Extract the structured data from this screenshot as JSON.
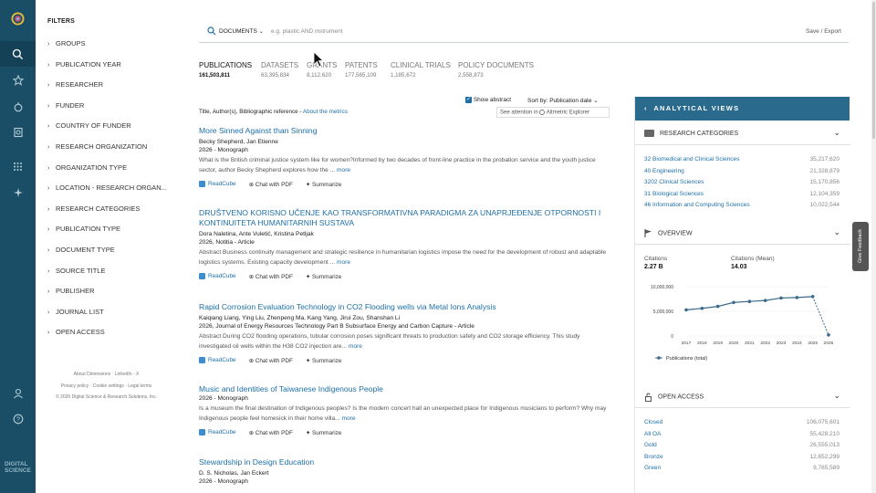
{
  "nav": {
    "icons": [
      "logo-icon",
      "search-icon",
      "star-icon",
      "saved-searches-icon",
      "history-icon",
      "apps-icon",
      "sparkle-icon",
      "user-icon",
      "help-icon"
    ],
    "brand": [
      "DIGITAL",
      "SCIENCE"
    ]
  },
  "filters": {
    "title": "FILTERS",
    "items": [
      "GROUPS",
      "PUBLICATION YEAR",
      "RESEARCHER",
      "FUNDER",
      "COUNTRY OF FUNDER",
      "RESEARCH ORGANIZATION",
      "ORGANIZATION TYPE",
      "LOCATION - RESEARCH ORGAN...",
      "RESEARCH CATEGORIES",
      "PUBLICATION TYPE",
      "DOCUMENT TYPE",
      "SOURCE TITLE",
      "PUBLISHER",
      "JOURNAL LIST",
      "OPEN ACCESS"
    ],
    "footer1": "About Dimensions · LinkedIn · X",
    "footer2": "Privacy policy · Cookie settings · Legal terms",
    "footer3": "© 2026 Digital Science & Research Solutions, Inc."
  },
  "search": {
    "scope": "DOCUMENTS",
    "placeholder": "e.g. plastic AND instrument",
    "save_export": "Save / Export"
  },
  "tabs": [
    {
      "label": "PUBLICATIONS",
      "count": "161,503,811"
    },
    {
      "label": "DATASETS",
      "count": "63,395,834"
    },
    {
      "label": "GRANTS",
      "count": "8,112,620"
    },
    {
      "label": "PATENTS",
      "count": "177,565,109"
    },
    {
      "label": "CLINICAL TRIALS",
      "count": "1,185,672"
    },
    {
      "label": "POLICY DOCUMENTS",
      "count": "2,558,873"
    }
  ],
  "options": {
    "show_abstract": "Show abstract",
    "sort_by": "Sort by:",
    "sort_value": "Publication date",
    "bib": "Title, Author(s), Bibliographic reference -",
    "metrics_link": "About the metrics",
    "altmetric": "See attention in",
    "altmetric_name": "Altmetric Explorer"
  },
  "actions": {
    "readcube": "ReadCube",
    "chat": "Chat with PDF",
    "summarize": "Summarize",
    "more": "more"
  },
  "publications": [
    {
      "title": "More Sinned Against than Sinning",
      "authors": "Becky Shepherd, Jan Etienne",
      "meta": "2026 - Monograph",
      "abstract": "What is the British criminal justice system like for women?Informed by two decades of front-line practice in the probation service and the youth justice sector, author Becky Shepherd explores how the ..."
    },
    {
      "title": "DRUŠTVENO KORISNO UČENJE KAO TRANSFORMATIVNA PARADIGMA ZA UNAPRJEĐENJE OTPORNOSTI I KONTINUITETA HUMANITARNIH SUSTAVA",
      "authors": "Dora Naletina, Ante Vuletić, Kristina Petljak",
      "meta": "2026, Notitia - Article",
      "abstract": "Abstract Business continuity management and strategic resilience in humanitarian logistics impose the need for the development of robust and adaptable logistics systems. Existing capacity development ..."
    },
    {
      "title": "Rapid Corrosion Evaluation Technology in CO2 Flooding wells via Metal Ions Analysis",
      "authors": "Kaiqiang Liang, Ying Liu, Zhenpeng Ma, Kang Yang, Jirui Zou, Shanshan Li",
      "meta": "2026, Journal of Energy Resources Technology Part B Subsurface Energy and Carbon Capture - Article",
      "abstract": "Abstract During CO2 flooding operations, tubular corrosion poses significant threats to production safety and CO2 storage efficiency. This study investigated oil wells within the H38 CO2 injection are..."
    },
    {
      "title": "Music and Identities of Taiwanese Indigenous People",
      "authors": "",
      "meta": "2026 - Monograph",
      "abstract": "Is a museum the final destination of Indigenous peoples? Is the modern concert hall an unexpected place for Indigenous musicians to perform? Why may Indigenous people feel homesick in their home villa..."
    },
    {
      "title": "Stewardship in Design Education",
      "authors": "D. S. Nicholas, Jan Eckert",
      "meta": "2026 - Monograph",
      "abstract": ""
    }
  ],
  "panel": {
    "title": "ANALYTICAL VIEWS",
    "categories_title": "RESEARCH CATEGORIES",
    "categories": [
      {
        "label": "32 Biomedical and Clinical Sciences",
        "value": "35,217,620"
      },
      {
        "label": "40 Engineering",
        "value": "21,328,879"
      },
      {
        "label": "3202 Clinical Sciences",
        "value": "15,170,856"
      },
      {
        "label": "31 Biological Sciences",
        "value": "12,104,359"
      },
      {
        "label": "46 Information and Computing Sciences",
        "value": "10,022,544"
      }
    ],
    "overview_title": "OVERVIEW",
    "citations_label": "Citations",
    "citations_value": "2.27 B",
    "citations_mean_label": "Citations (Mean)",
    "citations_mean_value": "14.03",
    "oa_title": "OPEN ACCESS",
    "oa": [
      {
        "label": "Closed",
        "value": "106,075,601"
      },
      {
        "label": "All OA",
        "value": "55,428,210"
      },
      {
        "label": "Gold",
        "value": "26,555,013"
      },
      {
        "label": "Bronze",
        "value": "12,652,299"
      },
      {
        "label": "Green",
        "value": "9,765,589"
      }
    ]
  },
  "feedback": "Give Feedback",
  "chart_data": {
    "type": "line",
    "x": [
      "2017",
      "2018",
      "2019",
      "2020",
      "2021",
      "2022",
      "2023",
      "2024",
      "2025",
      "2026"
    ],
    "series": [
      {
        "name": "Publications (total)",
        "values": [
          5300000,
          5600000,
          6000000,
          6800000,
          7000000,
          7200000,
          7700000,
          7800000,
          8000000,
          200000
        ],
        "color": "#3a6a8c"
      }
    ],
    "ylim": [
      0,
      10000000
    ],
    "yticks": [
      "10,000,000",
      "5,000,000",
      "0"
    ],
    "grid": true,
    "legend": "bottom"
  }
}
